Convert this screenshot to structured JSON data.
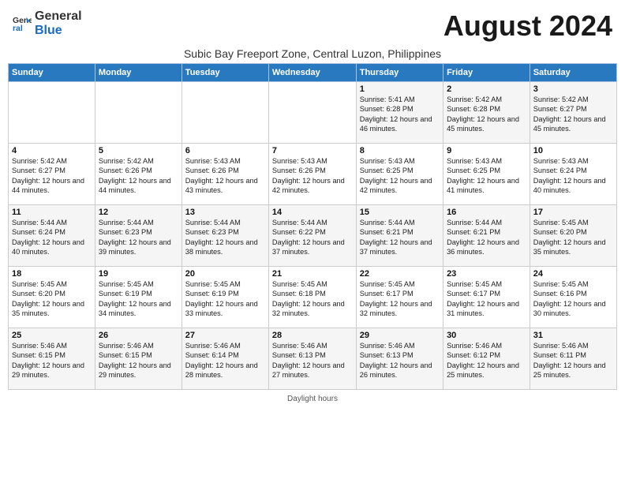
{
  "header": {
    "logo_general": "General",
    "logo_blue": "Blue",
    "month_title": "August 2024",
    "subtitle": "Subic Bay Freeport Zone, Central Luzon, Philippines"
  },
  "days_of_week": [
    "Sunday",
    "Monday",
    "Tuesday",
    "Wednesday",
    "Thursday",
    "Friday",
    "Saturday"
  ],
  "weeks": [
    [
      {
        "day": "",
        "sunrise": "",
        "sunset": "",
        "daylight": ""
      },
      {
        "day": "",
        "sunrise": "",
        "sunset": "",
        "daylight": ""
      },
      {
        "day": "",
        "sunrise": "",
        "sunset": "",
        "daylight": ""
      },
      {
        "day": "",
        "sunrise": "",
        "sunset": "",
        "daylight": ""
      },
      {
        "day": "1",
        "sunrise": "Sunrise: 5:41 AM",
        "sunset": "Sunset: 6:28 PM",
        "daylight": "Daylight: 12 hours and 46 minutes."
      },
      {
        "day": "2",
        "sunrise": "Sunrise: 5:42 AM",
        "sunset": "Sunset: 6:28 PM",
        "daylight": "Daylight: 12 hours and 45 minutes."
      },
      {
        "day": "3",
        "sunrise": "Sunrise: 5:42 AM",
        "sunset": "Sunset: 6:27 PM",
        "daylight": "Daylight: 12 hours and 45 minutes."
      }
    ],
    [
      {
        "day": "4",
        "sunrise": "Sunrise: 5:42 AM",
        "sunset": "Sunset: 6:27 PM",
        "daylight": "Daylight: 12 hours and 44 minutes."
      },
      {
        "day": "5",
        "sunrise": "Sunrise: 5:42 AM",
        "sunset": "Sunset: 6:26 PM",
        "daylight": "Daylight: 12 hours and 44 minutes."
      },
      {
        "day": "6",
        "sunrise": "Sunrise: 5:43 AM",
        "sunset": "Sunset: 6:26 PM",
        "daylight": "Daylight: 12 hours and 43 minutes."
      },
      {
        "day": "7",
        "sunrise": "Sunrise: 5:43 AM",
        "sunset": "Sunset: 6:26 PM",
        "daylight": "Daylight: 12 hours and 42 minutes."
      },
      {
        "day": "8",
        "sunrise": "Sunrise: 5:43 AM",
        "sunset": "Sunset: 6:25 PM",
        "daylight": "Daylight: 12 hours and 42 minutes."
      },
      {
        "day": "9",
        "sunrise": "Sunrise: 5:43 AM",
        "sunset": "Sunset: 6:25 PM",
        "daylight": "Daylight: 12 hours and 41 minutes."
      },
      {
        "day": "10",
        "sunrise": "Sunrise: 5:43 AM",
        "sunset": "Sunset: 6:24 PM",
        "daylight": "Daylight: 12 hours and 40 minutes."
      }
    ],
    [
      {
        "day": "11",
        "sunrise": "Sunrise: 5:44 AM",
        "sunset": "Sunset: 6:24 PM",
        "daylight": "Daylight: 12 hours and 40 minutes."
      },
      {
        "day": "12",
        "sunrise": "Sunrise: 5:44 AM",
        "sunset": "Sunset: 6:23 PM",
        "daylight": "Daylight: 12 hours and 39 minutes."
      },
      {
        "day": "13",
        "sunrise": "Sunrise: 5:44 AM",
        "sunset": "Sunset: 6:23 PM",
        "daylight": "Daylight: 12 hours and 38 minutes."
      },
      {
        "day": "14",
        "sunrise": "Sunrise: 5:44 AM",
        "sunset": "Sunset: 6:22 PM",
        "daylight": "Daylight: 12 hours and 37 minutes."
      },
      {
        "day": "15",
        "sunrise": "Sunrise: 5:44 AM",
        "sunset": "Sunset: 6:21 PM",
        "daylight": "Daylight: 12 hours and 37 minutes."
      },
      {
        "day": "16",
        "sunrise": "Sunrise: 5:44 AM",
        "sunset": "Sunset: 6:21 PM",
        "daylight": "Daylight: 12 hours and 36 minutes."
      },
      {
        "day": "17",
        "sunrise": "Sunrise: 5:45 AM",
        "sunset": "Sunset: 6:20 PM",
        "daylight": "Daylight: 12 hours and 35 minutes."
      }
    ],
    [
      {
        "day": "18",
        "sunrise": "Sunrise: 5:45 AM",
        "sunset": "Sunset: 6:20 PM",
        "daylight": "Daylight: 12 hours and 35 minutes."
      },
      {
        "day": "19",
        "sunrise": "Sunrise: 5:45 AM",
        "sunset": "Sunset: 6:19 PM",
        "daylight": "Daylight: 12 hours and 34 minutes."
      },
      {
        "day": "20",
        "sunrise": "Sunrise: 5:45 AM",
        "sunset": "Sunset: 6:19 PM",
        "daylight": "Daylight: 12 hours and 33 minutes."
      },
      {
        "day": "21",
        "sunrise": "Sunrise: 5:45 AM",
        "sunset": "Sunset: 6:18 PM",
        "daylight": "Daylight: 12 hours and 32 minutes."
      },
      {
        "day": "22",
        "sunrise": "Sunrise: 5:45 AM",
        "sunset": "Sunset: 6:17 PM",
        "daylight": "Daylight: 12 hours and 32 minutes."
      },
      {
        "day": "23",
        "sunrise": "Sunrise: 5:45 AM",
        "sunset": "Sunset: 6:17 PM",
        "daylight": "Daylight: 12 hours and 31 minutes."
      },
      {
        "day": "24",
        "sunrise": "Sunrise: 5:45 AM",
        "sunset": "Sunset: 6:16 PM",
        "daylight": "Daylight: 12 hours and 30 minutes."
      }
    ],
    [
      {
        "day": "25",
        "sunrise": "Sunrise: 5:46 AM",
        "sunset": "Sunset: 6:15 PM",
        "daylight": "Daylight: 12 hours and 29 minutes."
      },
      {
        "day": "26",
        "sunrise": "Sunrise: 5:46 AM",
        "sunset": "Sunset: 6:15 PM",
        "daylight": "Daylight: 12 hours and 29 minutes."
      },
      {
        "day": "27",
        "sunrise": "Sunrise: 5:46 AM",
        "sunset": "Sunset: 6:14 PM",
        "daylight": "Daylight: 12 hours and 28 minutes."
      },
      {
        "day": "28",
        "sunrise": "Sunrise: 5:46 AM",
        "sunset": "Sunset: 6:13 PM",
        "daylight": "Daylight: 12 hours and 27 minutes."
      },
      {
        "day": "29",
        "sunrise": "Sunrise: 5:46 AM",
        "sunset": "Sunset: 6:13 PM",
        "daylight": "Daylight: 12 hours and 26 minutes."
      },
      {
        "day": "30",
        "sunrise": "Sunrise: 5:46 AM",
        "sunset": "Sunset: 6:12 PM",
        "daylight": "Daylight: 12 hours and 25 minutes."
      },
      {
        "day": "31",
        "sunrise": "Sunrise: 5:46 AM",
        "sunset": "Sunset: 6:11 PM",
        "daylight": "Daylight: 12 hours and 25 minutes."
      }
    ]
  ],
  "footer": {
    "note": "Daylight hours"
  }
}
